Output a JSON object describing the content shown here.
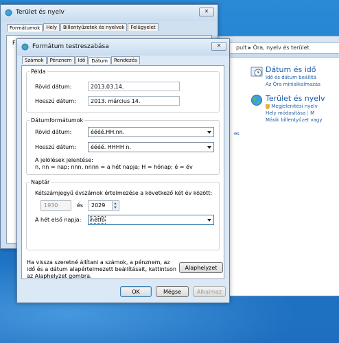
{
  "control_panel": {
    "path_text": "pult ▸ Óra, nyelv és terület",
    "datetime": {
      "title": "Dátum és idő",
      "link1": "Idő és dátum beállítá",
      "link2": "Az Óra minialkalmazás"
    },
    "region": {
      "title": "Terület és nyelv",
      "link1": "Megjelenítési nyelv",
      "link2a": "Hely módosítása",
      "link2b": "M",
      "link3": "Másik billentyűzet vagy"
    },
    "left_fragment": "es"
  },
  "back_dialog": {
    "title": "Terület és nyelv",
    "close": "✕",
    "tabs": [
      "Formátumok",
      "Hely",
      "Billentyűzetek és nyelvek",
      "Felügyelet"
    ],
    "fragment": "F"
  },
  "dialog": {
    "title": "Formátum testreszabása",
    "close": "✕",
    "tabs": [
      "Számok",
      "Pénznem",
      "Idő",
      "Dátum",
      "Rendezés"
    ],
    "example": {
      "legend": "Példa",
      "short_label": "Rövid dátum:",
      "short_value": "2013.03.14.",
      "long_label": "Hosszú dátum:",
      "long_value": "2013. március 14."
    },
    "formats": {
      "legend": "Dátumformátumok",
      "short_label": "Rövid dátum:",
      "short_value": "éééé.HH.nn.",
      "long_label": "Hosszú dátum:",
      "long_value": "éééé. HHHH n.",
      "notation_title": "A jelölések jelentése:",
      "notation_text": "n, nn = nap; nnn, nnnn = a hét napja; H = hónap; é = év"
    },
    "calendar": {
      "legend": "Naptár",
      "interpret_text": "Kétszámjegyű évszámok értelmezése a következő két év között:",
      "year_from": "1930",
      "and": "és",
      "year_to": "2029",
      "first_day_label": "A hét első napja:",
      "first_day_value": "hétfő"
    },
    "reset_text": "Ha vissza szeretné állítani a számok, a pénznem, az idő és a dátum alapértelmezett beállításait, kattintson az Alaphelyzet gombra.",
    "reset_button": "Alaphelyzet",
    "ok": "OK",
    "cancel": "Mégse",
    "apply": "Alkalmaz"
  },
  "colors": {
    "desktop": "#1d74c7",
    "link": "#1e5aa8",
    "dialog_frame": "#dbe8f5"
  }
}
